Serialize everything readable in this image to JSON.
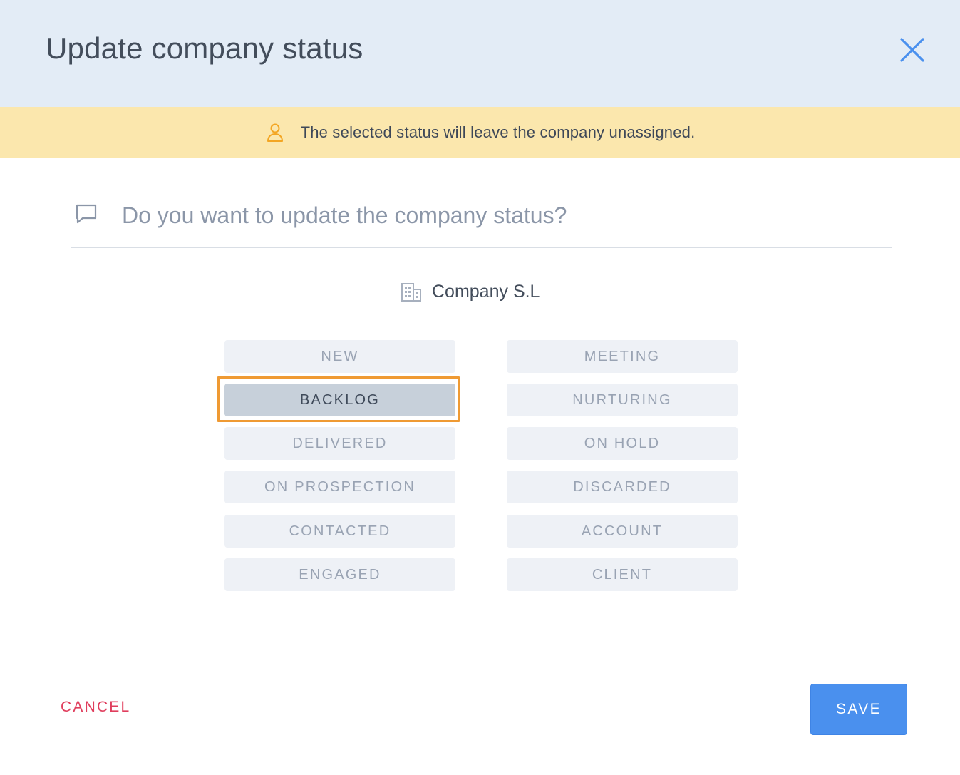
{
  "dialog": {
    "title": "Update company status",
    "warning": "The selected status will leave the company unassigned.",
    "question_placeholder": "Do you want to update the company status?",
    "company_name": "Company S.L"
  },
  "statuses": {
    "left": [
      "NEW",
      "BACKLOG",
      "DELIVERED",
      "ON PROSPECTION",
      "CONTACTED",
      "ENGAGED"
    ],
    "right": [
      "MEETING",
      "NURTURING",
      "ON HOLD",
      "DISCARDED",
      "ACCOUNT",
      "CLIENT"
    ],
    "selected": "BACKLOG"
  },
  "footer": {
    "cancel_label": "CANCEL",
    "save_label": "SAVE"
  },
  "icons": {
    "close": "close-icon",
    "warning": "person-icon",
    "question": "chat-bubble-icon",
    "company": "building-icon"
  },
  "colors": {
    "header_bg": "#e3ecf6",
    "warning_bg": "#fbe7ad",
    "accent": "#4a90ee",
    "cancel": "#e03e5d",
    "focus": "#ef9a33",
    "selected_bg": "#c7d0da",
    "status_bg": "#eef1f6"
  }
}
